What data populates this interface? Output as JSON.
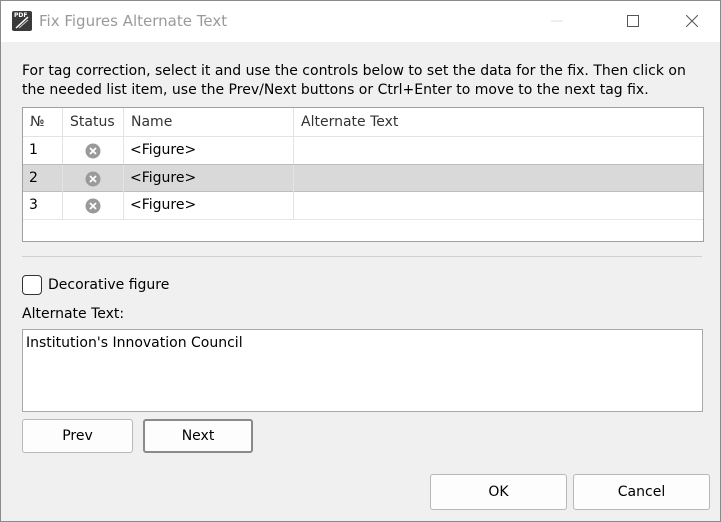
{
  "window": {
    "title": "Fix Figures Alternate Text",
    "icon_label": "PDF"
  },
  "instructions": "For tag correction, select it and use the controls below to set the data for the fix. Then click on the needed list item, use the Prev/Next buttons or Ctrl+Enter to move to the next tag fix.",
  "table": {
    "columns": [
      "№",
      "Status",
      "Name",
      "Alternate Text"
    ],
    "rows": [
      {
        "no": "1",
        "status": "error-icon",
        "name": "<Figure>",
        "alt": ""
      },
      {
        "no": "2",
        "status": "error-icon",
        "name": "<Figure>",
        "alt": "",
        "selected": true
      },
      {
        "no": "3",
        "status": "error-icon",
        "name": "<Figure>",
        "alt": ""
      }
    ]
  },
  "decorative": {
    "label": "Decorative figure",
    "checked": false
  },
  "alt_text": {
    "label": "Alternate Text:",
    "value": "Institution's Innovation Council"
  },
  "buttons": {
    "prev": "Prev",
    "next": "Next",
    "ok": "OK",
    "cancel": "Cancel"
  },
  "colors": {
    "selected_row": "#d9d9d9",
    "status_icon": "#9a9a9a"
  }
}
